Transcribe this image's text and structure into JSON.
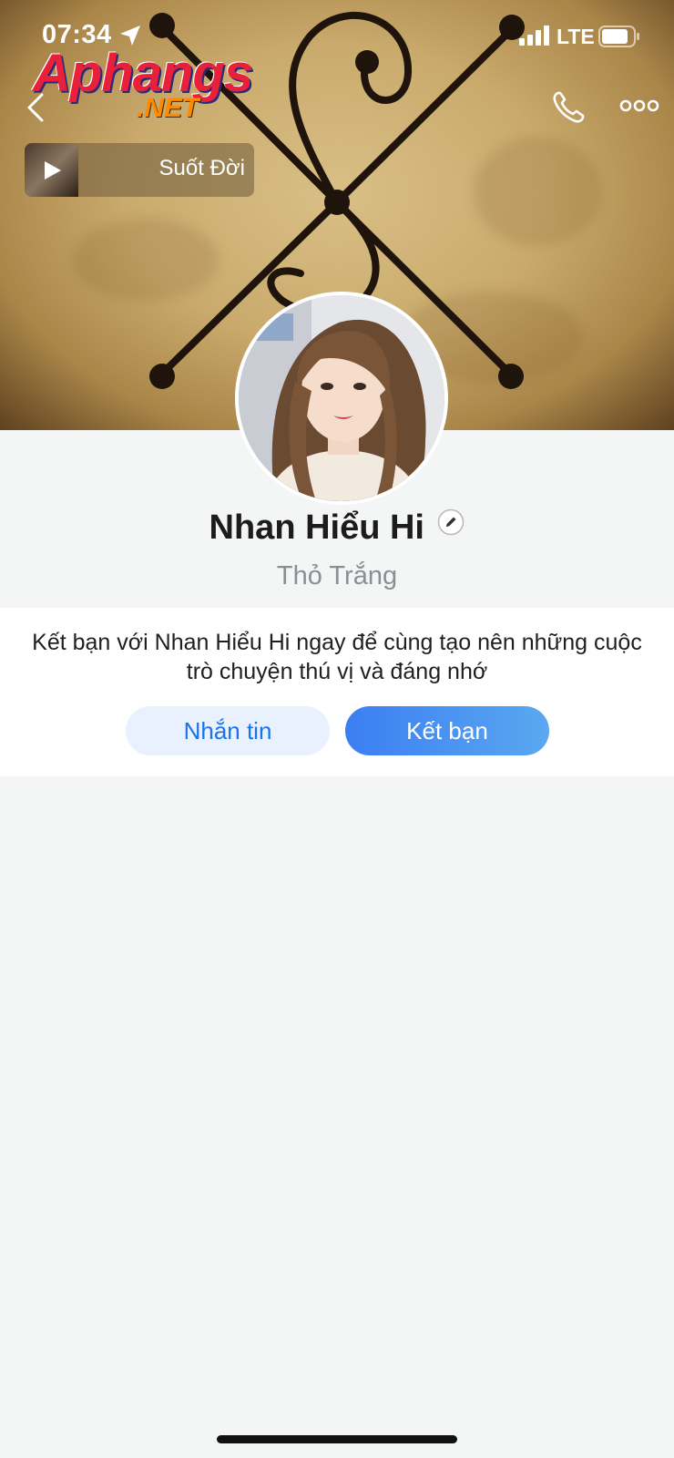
{
  "status_bar": {
    "time": "07:34",
    "network": "LTE"
  },
  "watermark": {
    "main_text": "Aphangs",
    "sub_text": ".NET"
  },
  "header": {
    "icons": [
      "back-icon",
      "phone-icon",
      "more-icon"
    ]
  },
  "music": {
    "title": "Suốt Đời"
  },
  "profile": {
    "name": "Nhan Hiểu Hi",
    "nickname": "Thỏ Trắng"
  },
  "friend_card": {
    "description": "Kết bạn với Nhan Hiểu Hi ngay để cùng tạo nên những cuộc trò chuyện thú vị và đáng nhớ",
    "message_label": "Nhắn tin",
    "add_friend_label": "Kết bạn"
  },
  "colors": {
    "accent": "#1a73e8",
    "background": "#f4f5f5"
  }
}
